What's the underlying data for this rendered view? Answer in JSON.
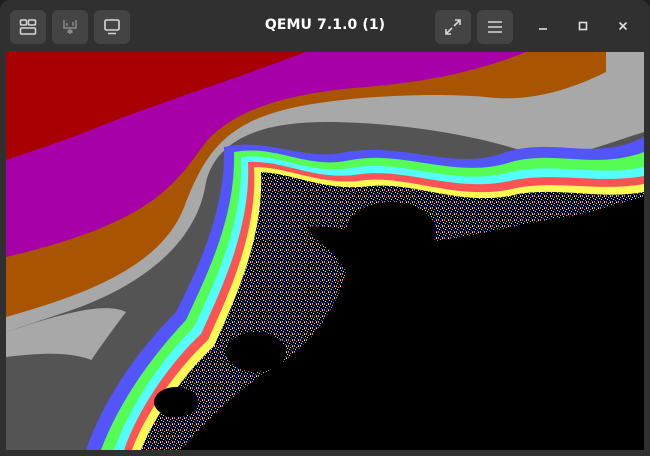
{
  "window": {
    "title": "QEMU 7.1.0 (1)"
  },
  "toolbar": {
    "left_buttons": [
      {
        "name": "detach-tab-button",
        "icon": "detach-tab-icon"
      },
      {
        "name": "usb-devices-button",
        "icon": "usb-plug-icon"
      },
      {
        "name": "display-button",
        "icon": "monitor-icon"
      }
    ],
    "right_buttons": [
      {
        "name": "fullscreen-button",
        "icon": "expand-arrows-icon"
      },
      {
        "name": "menu-button",
        "icon": "hamburger-menu-icon"
      }
    ],
    "window_controls": [
      "minimize-icon",
      "maximize-icon",
      "close-icon"
    ]
  },
  "colors": {
    "titlebar_bg": "#303030",
    "button_bg": "#444444",
    "icon_fg": "#d8d8d8",
    "fractal_palette": [
      "#a80000",
      "#a800a8",
      "#a85400",
      "#a8a8a8",
      "#545454",
      "#5454fc",
      "#54fc54",
      "#54fcfc",
      "#fc5454",
      "#fcfc54",
      "#ffffff",
      "#000000"
    ]
  }
}
